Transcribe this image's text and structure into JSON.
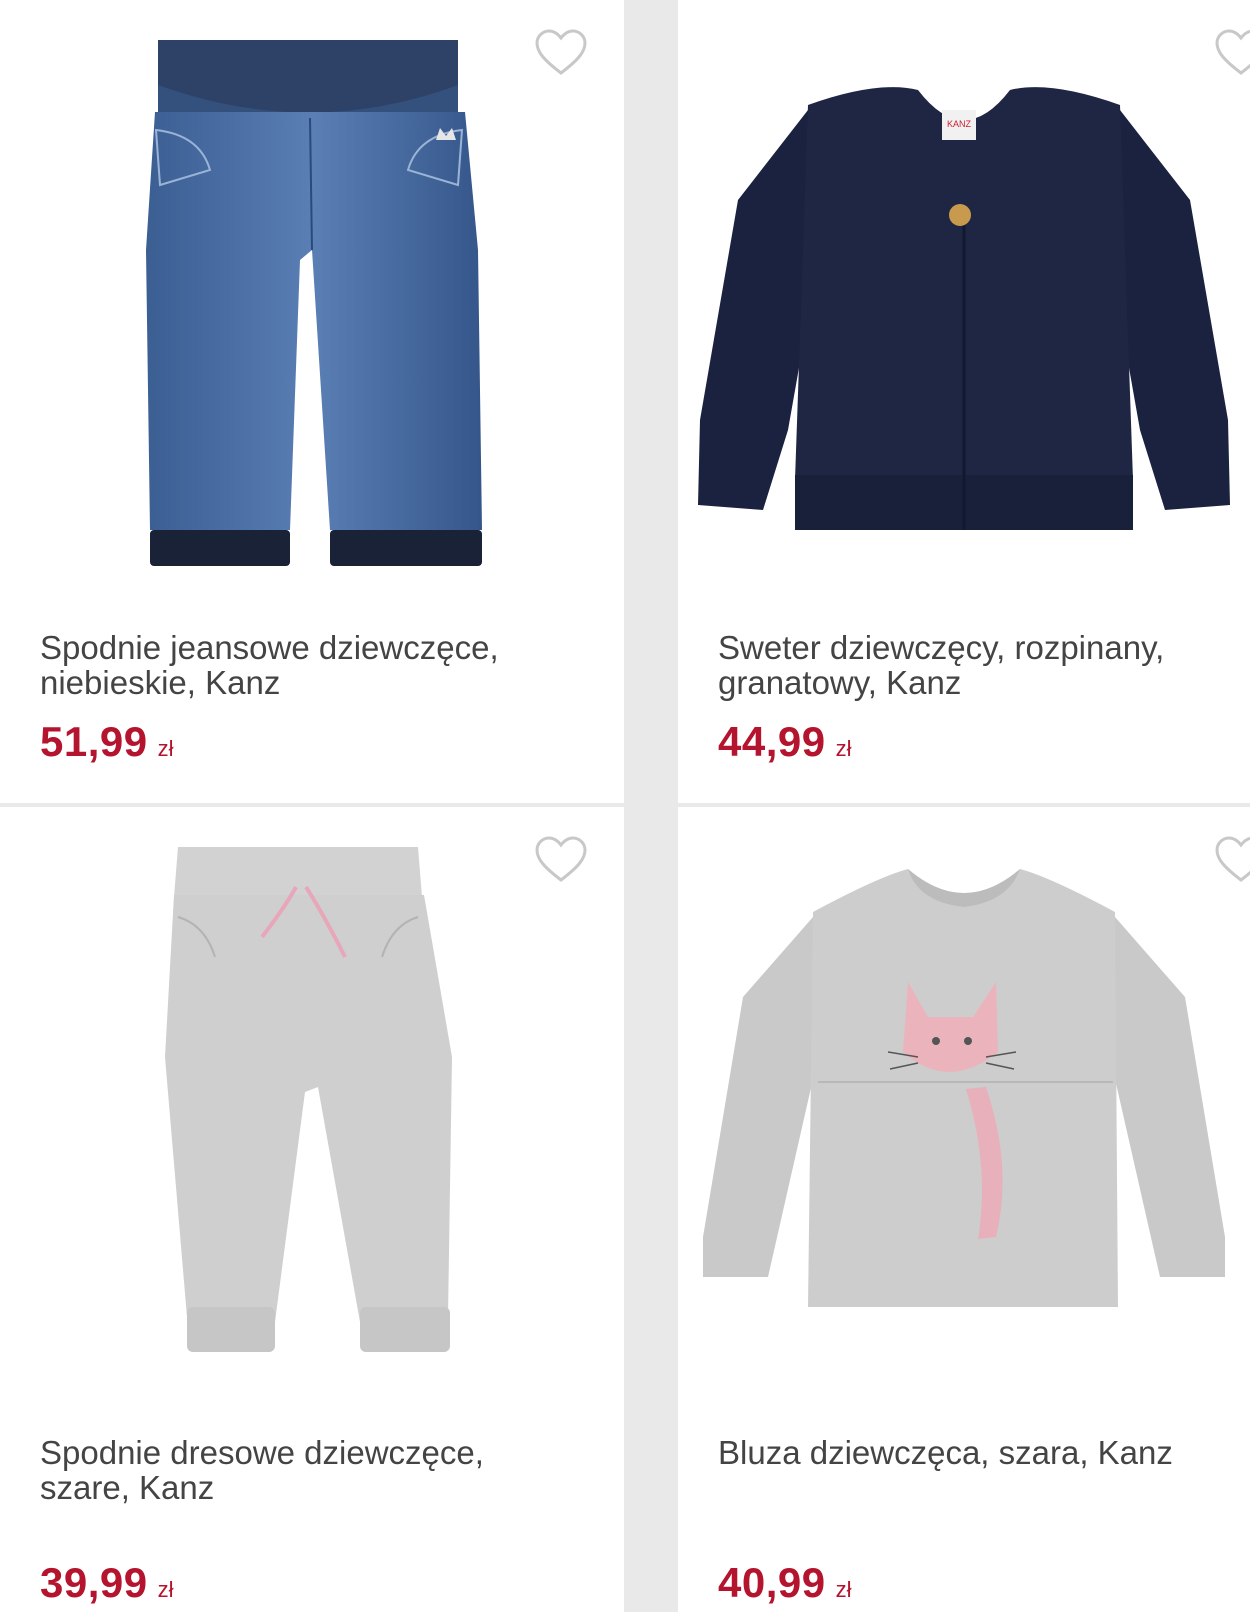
{
  "products": [
    {
      "title": "Spodnie jeansowe dziewczęce, niebieskie, Kanz",
      "price": "51,99",
      "currency": "zł",
      "image_icon": "jeans-image"
    },
    {
      "title": "Sweter dziewczęcy, rozpinany, granatowy, Kanz",
      "price": "44,99",
      "currency": "zł",
      "image_icon": "cardigan-image"
    },
    {
      "title": "Spodnie dresowe dziewczęce, szare, Kanz",
      "price": "39,99",
      "currency": "zł",
      "image_icon": "sweatpants-image"
    },
    {
      "title": "Bluza dziewczęca, szara, Kanz",
      "price": "40,99",
      "currency": "zł",
      "image_icon": "sweatshirt-image"
    }
  ],
  "colors": {
    "price": "#b5142e",
    "title": "#444444",
    "background": "#e9e9e9",
    "card": "#ffffff",
    "heart": "#c8c8c8"
  },
  "icons": {
    "favorite": "heart-outline-icon"
  }
}
